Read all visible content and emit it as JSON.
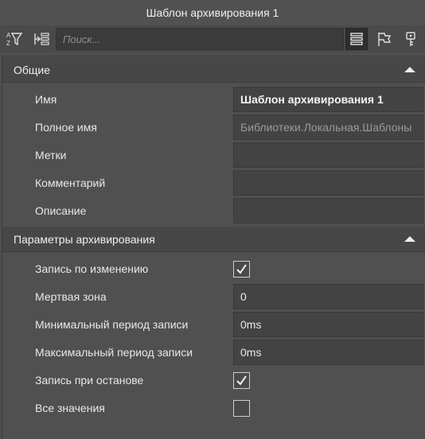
{
  "window": {
    "title": "Шаблон архивирования 1"
  },
  "toolbar": {
    "search_placeholder": "Поиск...",
    "buttons": [
      {
        "name": "sort-filter-icon",
        "active": false
      },
      {
        "name": "categorize-icon",
        "active": false
      },
      {
        "name": "list-view-icon",
        "active": true
      },
      {
        "name": "flag-icon",
        "active": false
      },
      {
        "name": "key-icon",
        "active": false
      }
    ]
  },
  "sections": {
    "general": {
      "title": "Общие",
      "rows": [
        {
          "label": "Имя",
          "value": "Шаблон архивирования 1"
        },
        {
          "label": "Полное имя",
          "value": "Библиотеки.Локальная.Шаблоны"
        },
        {
          "label": "Метки",
          "value": ""
        },
        {
          "label": "Комментарий",
          "value": ""
        },
        {
          "label": "Описание",
          "value": ""
        }
      ]
    },
    "archive": {
      "title": "Параметры архивирования",
      "rows": [
        {
          "label": "Запись по изменению",
          "checked": true
        },
        {
          "label": "Мертвая зона",
          "value": "0"
        },
        {
          "label": "Минимальный период записи",
          "value": "0ms"
        },
        {
          "label": "Максимальный период записи",
          "value": "0ms"
        },
        {
          "label": "Запись при останове",
          "checked": true
        },
        {
          "label": "Все значения",
          "checked": false
        }
      ]
    }
  },
  "colors": {
    "background": "#505050",
    "field": "#434343",
    "header": "#474747",
    "check": "#f0f0f0"
  }
}
